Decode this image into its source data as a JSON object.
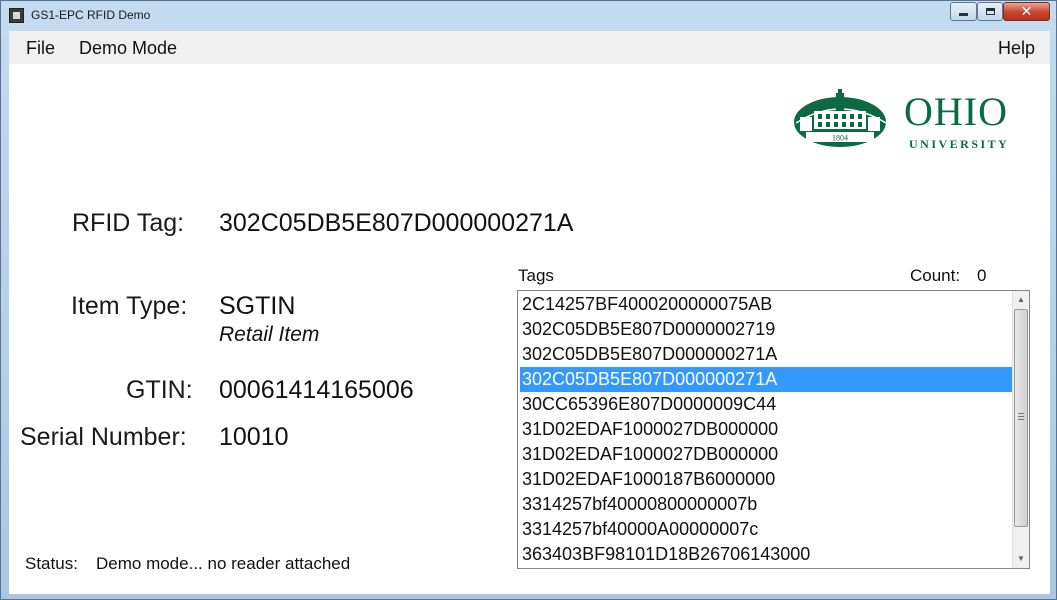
{
  "window": {
    "title": "GS1-EPC RFID Demo",
    "controls": {
      "minimize": "minimize",
      "maximize": "maximize",
      "close": "✕"
    }
  },
  "menu": {
    "file": "File",
    "demo_mode": "Demo Mode",
    "help": "Help"
  },
  "logo": {
    "word1": "OHIO",
    "word2": "UNIVERSITY",
    "year": "1804",
    "primary_color": "#0b6a44"
  },
  "rfid": {
    "label": "RFID Tag:",
    "value": "302C05DB5E807D000000271A"
  },
  "item_type": {
    "label": "Item Type:",
    "value": "SGTIN",
    "subvalue": "Retail Item"
  },
  "gtin": {
    "label": "GTIN:",
    "value": "00061414165006"
  },
  "serial": {
    "label": "Serial Number:",
    "value": "10010"
  },
  "status": {
    "label": "Status:",
    "value": "Demo mode... no reader attached"
  },
  "tags": {
    "header": "Tags",
    "count_label": "Count:",
    "count_value": "0",
    "items": [
      "2C14257BF4000200000075AB",
      "302C05DB5E807D0000002719",
      "302C05DB5E807D000000271A",
      "302C05DB5E807D000000271A",
      "30CC65396E807D0000009C44",
      "31D02EDAF1000027DB000000",
      "31D02EDAF1000027DB000000",
      "31D02EDAF1000187B6000000",
      "3314257bf40000800000007b",
      "3314257bf40000A00000007c",
      "363403BF98101D18B26706143000"
    ],
    "selected_index": 3,
    "selection_color": "#3399ff"
  }
}
